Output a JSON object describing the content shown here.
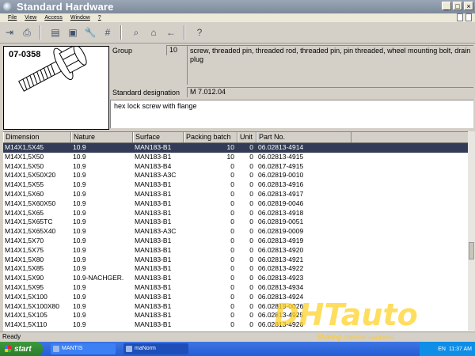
{
  "window": {
    "title": "Standard Hardware",
    "minimize": "_",
    "maximize": "□",
    "close": "×"
  },
  "menu": [
    "File",
    "View",
    "Access",
    "Window",
    "?"
  ],
  "part": {
    "code": "07-0358",
    "group_label": "Group",
    "group_number": "10",
    "group_desc": "screw, threaded pin, threaded rod, threaded pin, pin threaded, wheel mounting bolt, drain plug",
    "designation_label": "Standard designation",
    "designation": "M 7.012.04",
    "description": "hex lock screw with flange"
  },
  "table": {
    "columns": [
      "Dimension",
      "Nature",
      "Surface",
      "Packing batch",
      "Unit",
      "Part No."
    ],
    "rows": [
      [
        "M14X1,5X45",
        "10.9",
        "MAN183-B1",
        "10",
        "0",
        "06.02813-4914"
      ],
      [
        "M14X1,5X50",
        "10.9",
        "MAN183-B1",
        "10",
        "0",
        "06.02813-4915"
      ],
      [
        "M14X1,5X50",
        "10.9",
        "MAN183-B4",
        "0",
        "0",
        "06.02817-4915"
      ],
      [
        "M14X1,5X50X20",
        "10.9",
        "MAN183-A3C",
        "0",
        "0",
        "06.02819-0010"
      ],
      [
        "M14X1,5X55",
        "10.9",
        "MAN183-B1",
        "0",
        "0",
        "06.02813-4916"
      ],
      [
        "M14X1,5X60",
        "10.9",
        "MAN183-B1",
        "0",
        "0",
        "06.02813-4917"
      ],
      [
        "M14X1,5X60X50",
        "10.9",
        "MAN183-B1",
        "0",
        "0",
        "06.02819-0046"
      ],
      [
        "M14X1,5X65",
        "10.9",
        "MAN183-B1",
        "0",
        "0",
        "06.02813-4918"
      ],
      [
        "M14X1,5X65TC",
        "10.9",
        "MAN183-B1",
        "0",
        "0",
        "06.02819-0051"
      ],
      [
        "M14X1,5X65X40",
        "10.9",
        "MAN183-A3C",
        "0",
        "0",
        "06.02819-0009"
      ],
      [
        "M14X1,5X70",
        "10.9",
        "MAN183-B1",
        "0",
        "0",
        "06.02813-4919"
      ],
      [
        "M14X1,5X75",
        "10.9",
        "MAN183-B1",
        "0",
        "0",
        "06.02813-4920"
      ],
      [
        "M14X1,5X80",
        "10.9",
        "MAN183-B1",
        "0",
        "0",
        "06.02813-4921"
      ],
      [
        "M14X1,5X85",
        "10.9",
        "MAN183-B1",
        "0",
        "0",
        "06.02813-4922"
      ],
      [
        "M14X1,5X90",
        "10.9-NACHGER.",
        "MAN183-B1",
        "0",
        "0",
        "06.02813-4923"
      ],
      [
        "M14X1,5X95",
        "10.9",
        "MAN183-B1",
        "0",
        "0",
        "06.02813-4934"
      ],
      [
        "M14X1,5X100",
        "10.9",
        "MAN183-B1",
        "0",
        "0",
        "06.02813-4924"
      ],
      [
        "M14X1,5X100X80",
        "10.9",
        "MAN183-B1",
        "0",
        "0",
        "06.02819-0026"
      ],
      [
        "M14X1,5X105",
        "10.9",
        "MAN183-B1",
        "0",
        "0",
        "06.02813-4925"
      ],
      [
        "M14X1,5X110",
        "10.9",
        "MAN183-B1",
        "0",
        "0",
        "06.02813-4926"
      ]
    ]
  },
  "status": "Ready",
  "taskbar": {
    "start": "start",
    "items": [
      "MANTIS",
      "maNorm"
    ],
    "lang": "EN",
    "clock": "11:37 AM"
  },
  "watermark": {
    "logo": "DHTauto",
    "tagline": "Sharing creates success"
  },
  "colors": {
    "selected_row": "#333c56",
    "titlebar": "#8794a6",
    "taskbar": "#2f66dc"
  }
}
